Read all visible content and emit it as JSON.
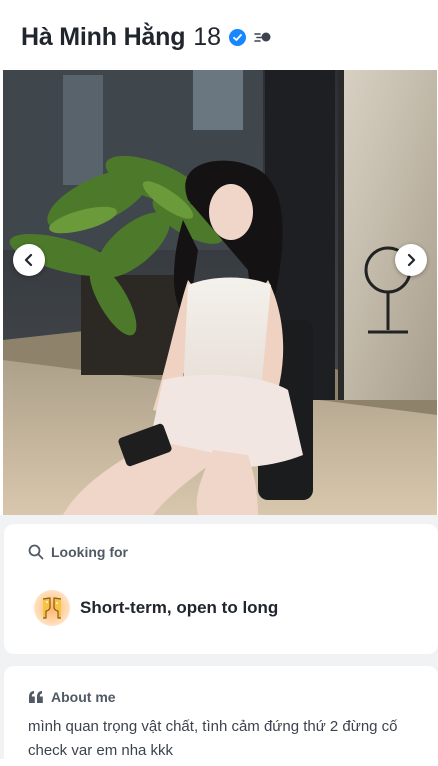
{
  "profile": {
    "name": "Hà Minh Hằng",
    "age": "18"
  },
  "icons": {
    "verified": "verified-badge-icon",
    "active": "recently-active-icon",
    "prev": "chevron-left-icon",
    "next": "chevron-right-icon",
    "search": "search-icon",
    "quote": "quote-icon",
    "cheers": "clinking-glasses-emoji"
  },
  "colors": {
    "verified_blue": "#1786ff",
    "text_primary": "#21262e",
    "section_background": "#f0f2f4"
  },
  "looking_for": {
    "label": "Looking for",
    "value": "Short-term, open to long"
  },
  "about": {
    "label": "About me",
    "text": "mình quan trọng vật chất, tình cảm đứng thứ 2 đừng cố check var em nha kkk"
  }
}
